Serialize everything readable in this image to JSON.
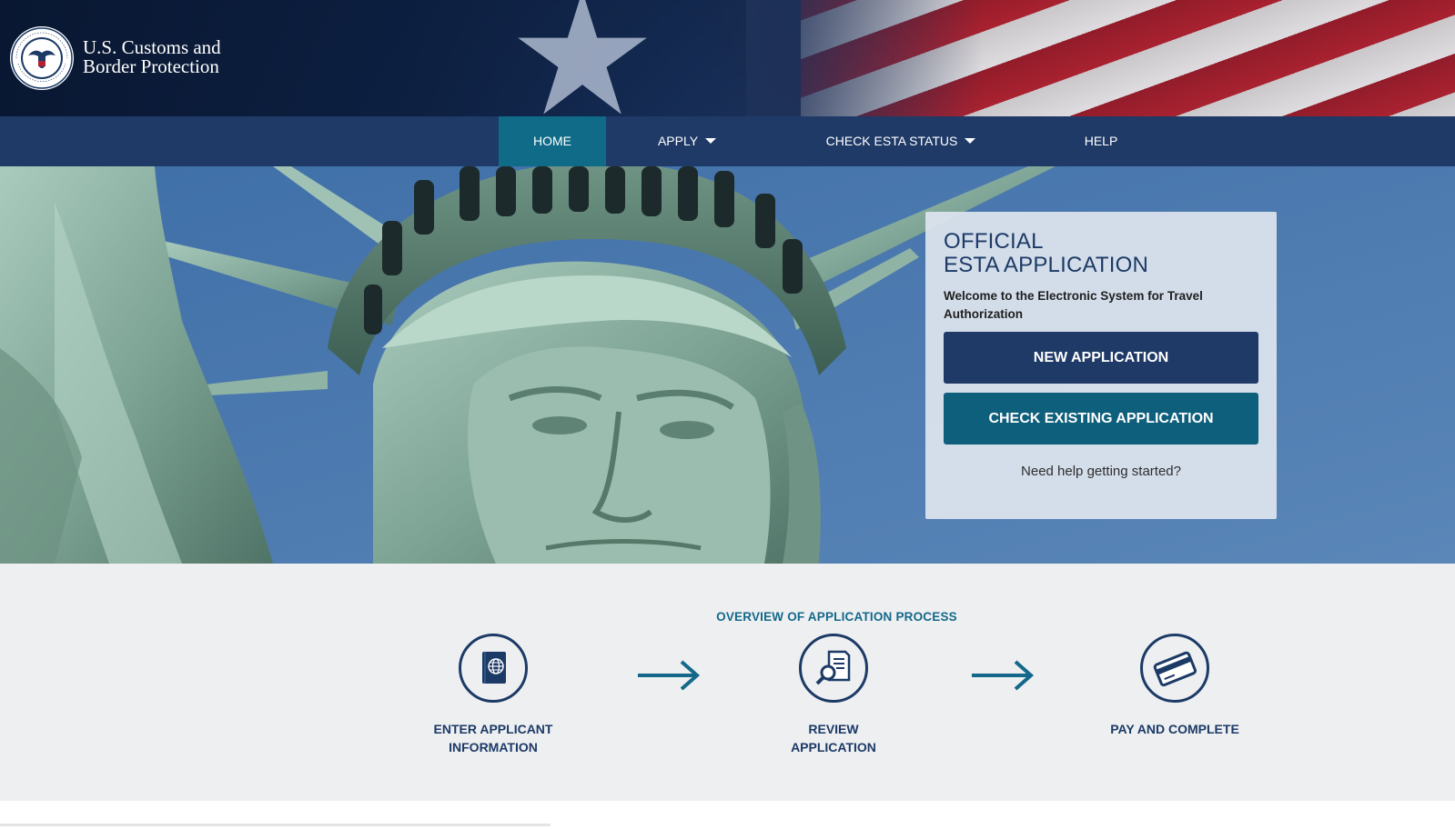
{
  "header": {
    "agency_line1": "U.S. Customs and",
    "agency_line2": "Border Protection",
    "seal_text": "U.S. DEPARTMENT OF HOMELAND SECURITY"
  },
  "nav": {
    "items": [
      {
        "label": "HOME",
        "active": true,
        "dropdown": false
      },
      {
        "label": "APPLY",
        "active": false,
        "dropdown": true
      },
      {
        "label": "CHECK ESTA STATUS",
        "active": false,
        "dropdown": true
      },
      {
        "label": "HELP",
        "active": false,
        "dropdown": false
      }
    ]
  },
  "card": {
    "heading_line1": "OFFICIAL",
    "heading_line2": "ESTA APPLICATION",
    "welcome": "Welcome to the Electronic System for Travel Authorization",
    "new_application": "NEW APPLICATION",
    "check_existing": "CHECK EXISTING APPLICATION",
    "help_link": "Need help getting started?"
  },
  "overview": {
    "title": "OVERVIEW OF APPLICATION PROCESS",
    "steps": [
      {
        "line1": "ENTER APPLICANT",
        "line2": "INFORMATION",
        "icon": "passport-icon"
      },
      {
        "line1": "REVIEW",
        "line2": "APPLICATION",
        "icon": "document-search-icon"
      },
      {
        "line1": "PAY AND COMPLETE",
        "line2": "",
        "icon": "credit-card-icon"
      }
    ]
  },
  "colors": {
    "nav_bg": "#1f3a67",
    "nav_active": "#0f6b88",
    "primary_button": "#1f3a67",
    "secondary_button": "#0e5f7b",
    "accent_text": "#14688a",
    "overview_bg": "#edeff1"
  }
}
